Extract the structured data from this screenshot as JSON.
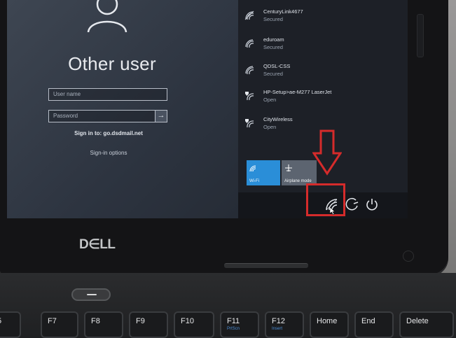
{
  "login": {
    "title": "Other user",
    "username_placeholder": "User name",
    "password_placeholder": "Password",
    "submit_arrow": "→",
    "signin_to": "Sign in to: go.dsdmail.net",
    "signin_options": "Sign-in options"
  },
  "networks": [
    {
      "name": "CenturyLink4677",
      "status": "Secured",
      "icon": "wifi-icon"
    },
    {
      "name": "eduroam",
      "status": "Secured",
      "icon": "wifi-icon"
    },
    {
      "name": "QDSL-CSS",
      "status": "Secured",
      "icon": "wifi-icon"
    },
    {
      "name": "HP-Setup>ae-M277 LaserJet",
      "status": "Open",
      "icon": "wifi-open-icon"
    },
    {
      "name": "CityWireless",
      "status": "Open",
      "icon": "wifi-open-icon"
    }
  ],
  "quick_actions": {
    "wifi_label": "Wi-Fi",
    "airplane_label": "Airplane mode",
    "wifi_color": "#2a8ed8"
  },
  "tray": {
    "icons": [
      "network-icon",
      "ease-of-access-icon",
      "power-icon"
    ]
  },
  "annotation": {
    "color": "#d52b2b"
  },
  "hardware": {
    "brand": "D∈LL",
    "keys": [
      {
        "label": "5"
      },
      {
        "label": "F7"
      },
      {
        "label": "F8"
      },
      {
        "label": "F9"
      },
      {
        "label": "F10"
      },
      {
        "label": "F11",
        "sub": "PrtScn"
      },
      {
        "label": "F12",
        "sub": "Insert"
      },
      {
        "label": "Home"
      },
      {
        "label": "End"
      },
      {
        "label": "Delete"
      }
    ]
  }
}
